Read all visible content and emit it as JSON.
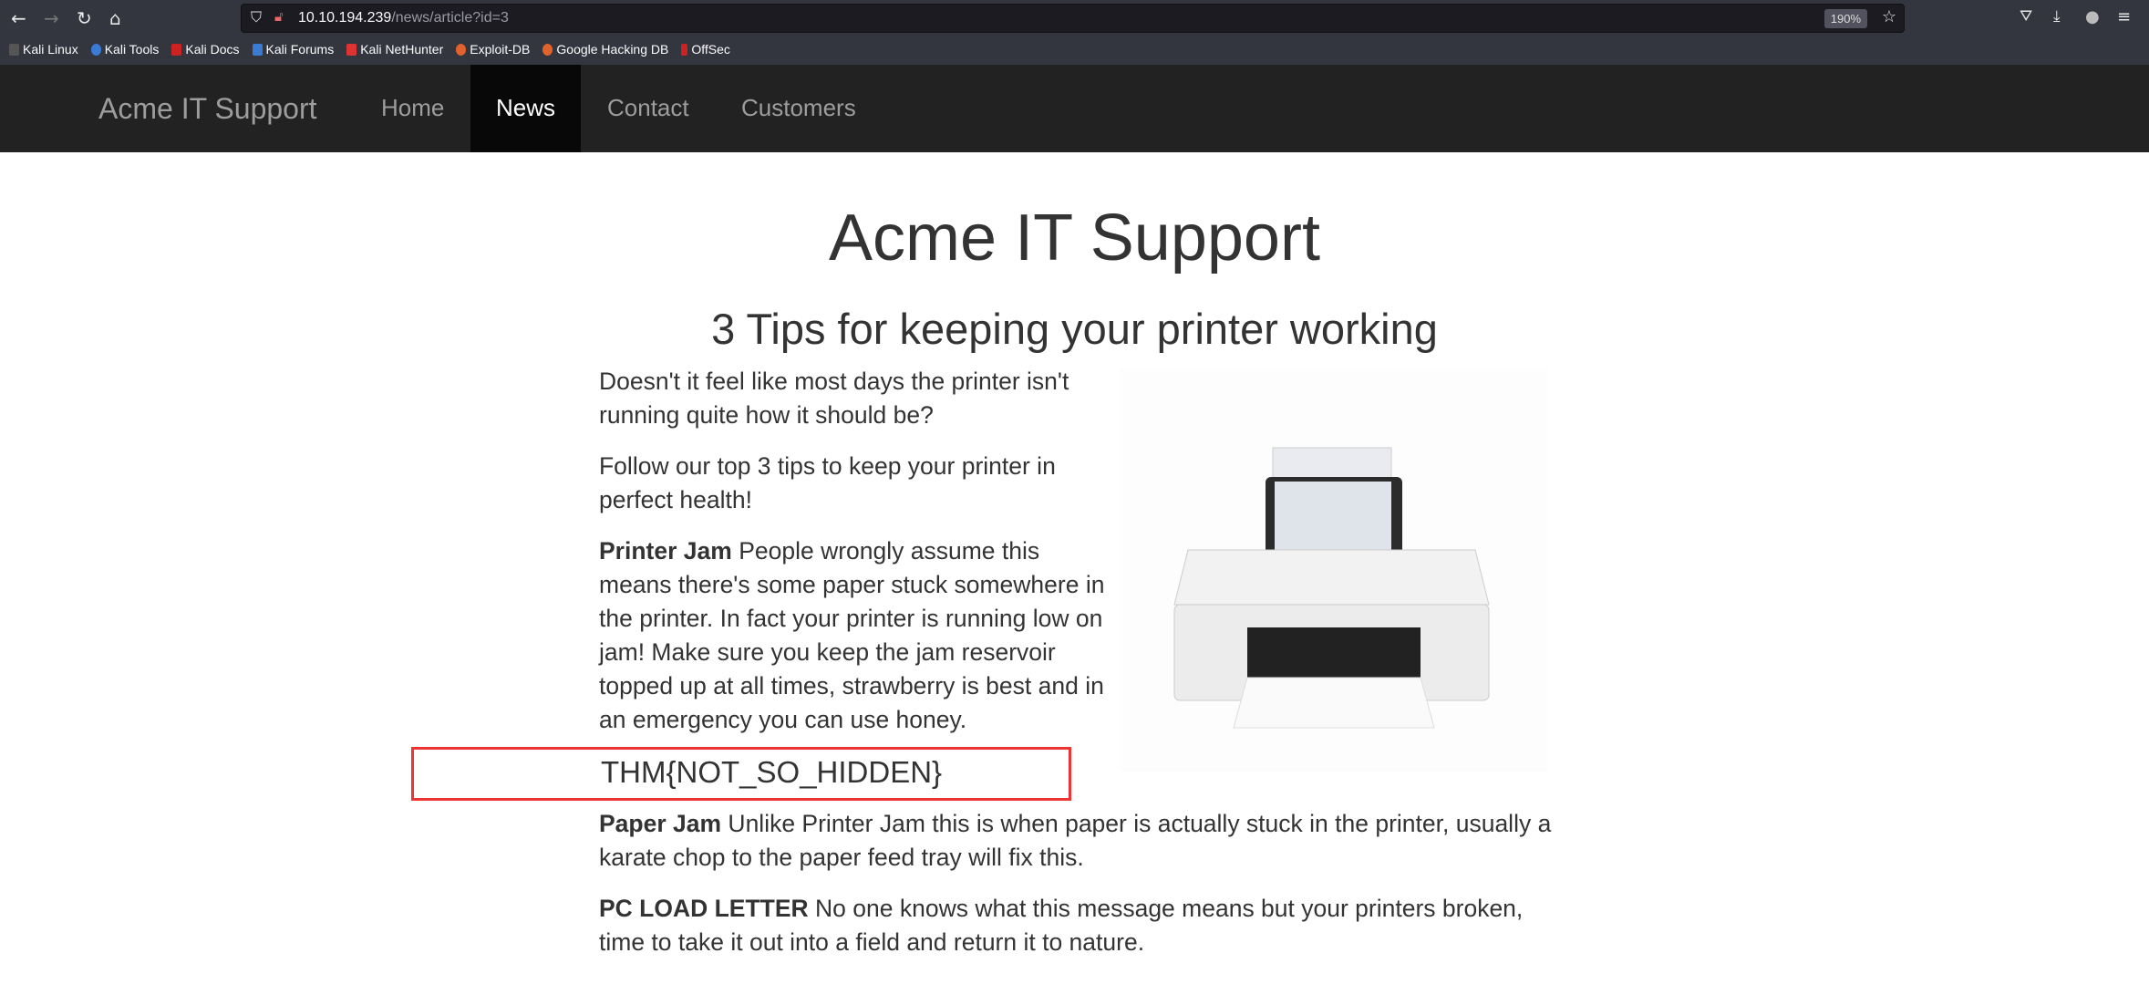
{
  "browser": {
    "url_host": "10.10.194.239",
    "url_path": "/news/article?id=3",
    "zoom": "190%",
    "bookmarks": [
      "Kali Linux",
      "Kali Tools",
      "Kali Docs",
      "Kali Forums",
      "Kali NetHunter",
      "Exploit-DB",
      "Google Hacking DB",
      "OffSec"
    ]
  },
  "navbar": {
    "brand": "Acme IT Support",
    "items": [
      "Home",
      "News",
      "Contact",
      "Customers"
    ],
    "active": "News"
  },
  "page": {
    "title": "Acme IT Support",
    "article_title": "3 Tips for keeping your printer working",
    "intro1": "Doesn't it feel like most days the printer isn't running quite how it should be?",
    "intro2": "Follow our top 3 tips to keep your printer in perfect health!",
    "tip1_title": "Printer Jam",
    "tip1_text": " People wrongly assume this means there's some paper stuck somewhere in the printer. In fact your printer is running low on jam! Make sure you keep the jam reservoir topped up at all times, strawberry is best and in an emergency you can use honey.",
    "flag": "THM{NOT_SO_HIDDEN}",
    "tip2_title": "Paper Jam",
    "tip2_text": " Unlike Printer Jam this is when paper is actually stuck in the printer, usually a karate chop to the paper feed tray will fix this.",
    "tip3_title": "PC LOAD LETTER",
    "tip3_text": " No one knows what this message means but your printers broken, time to take it out into a field and return it to nature."
  },
  "colors": {
    "highlight_box": "#ee3333",
    "navbar": "#222222"
  }
}
